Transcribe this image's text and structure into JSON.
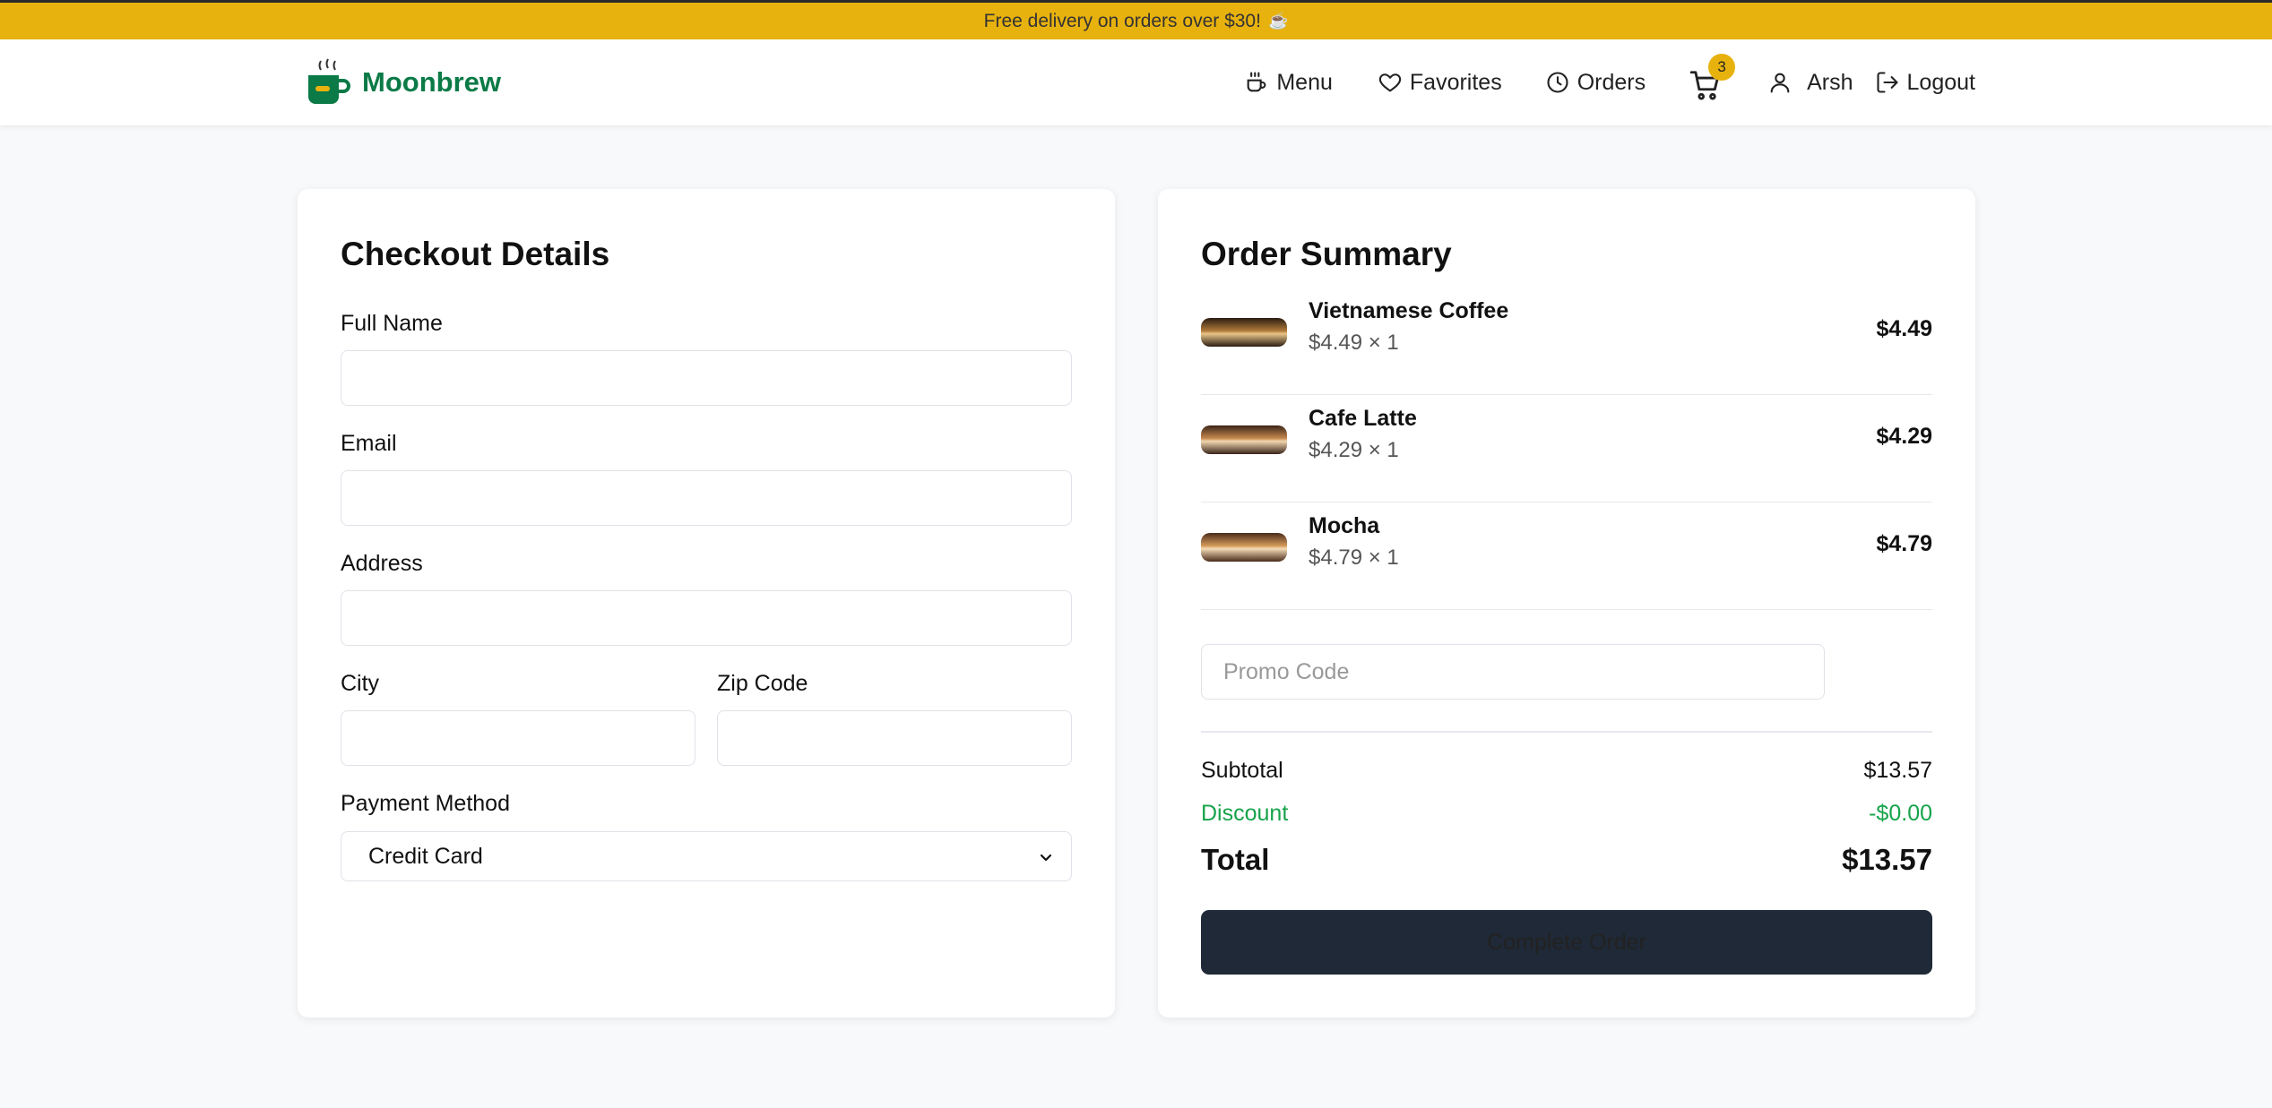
{
  "announcement": {
    "text": "Free delivery on orders over $30!",
    "icon": "coffee-icon"
  },
  "header": {
    "brand": "Moonbrew",
    "nav": {
      "menu": "Menu",
      "favorites": "Favorites",
      "orders": "Orders",
      "cart_count": "3",
      "user": "Arsh",
      "logout": "Logout"
    }
  },
  "checkout": {
    "title": "Checkout Details",
    "fields": {
      "full_name": {
        "label": "Full Name",
        "value": ""
      },
      "email": {
        "label": "Email",
        "value": ""
      },
      "address": {
        "label": "Address",
        "value": ""
      },
      "city": {
        "label": "City",
        "value": ""
      },
      "zip": {
        "label": "Zip Code",
        "value": ""
      }
    },
    "payment": {
      "label": "Payment Method",
      "selected": "Credit Card"
    }
  },
  "summary": {
    "title": "Order Summary",
    "items": [
      {
        "name": "Vietnamese Coffee",
        "qty_line": "$4.49 × 1",
        "price": "$4.49"
      },
      {
        "name": "Cafe Latte",
        "qty_line": "$4.29 × 1",
        "price": "$4.29"
      },
      {
        "name": "Mocha",
        "qty_line": "$4.79 × 1",
        "price": "$4.79"
      }
    ],
    "promo_placeholder": "Promo Code",
    "subtotal_label": "Subtotal",
    "subtotal": "$13.57",
    "discount_label": "Discount",
    "discount": "-$0.00",
    "total_label": "Total",
    "total": "$13.57",
    "complete_label": "Complete Order"
  },
  "colors": {
    "banner": "#e8b20e",
    "brand": "#0b7a47",
    "discount": "#16a34a",
    "button": "#1f2937"
  }
}
